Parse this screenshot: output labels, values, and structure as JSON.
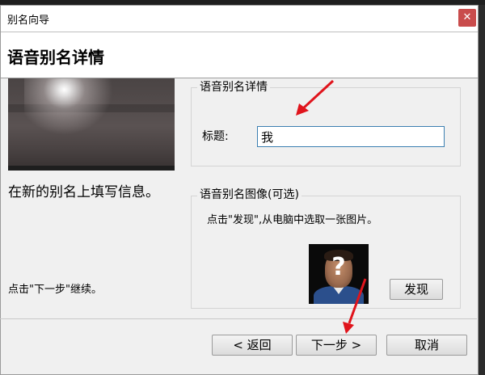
{
  "window": {
    "title": "别名向导",
    "close_glyph": "✕"
  },
  "header": {
    "title": "语音别名详情"
  },
  "sidebar": {
    "description": "在新的别名上填写信息。",
    "next_hint": "点击\"下一步\"继续。"
  },
  "details_group": {
    "title": "语音别名详情",
    "label": "标题:",
    "value": "我"
  },
  "image_group": {
    "title": "语音别名图像(可选)",
    "hint": "点击\"发现\",从电脑中选取一张图片。",
    "discover_label": "发现"
  },
  "footer": {
    "back_label": "< 返回",
    "next_label": "下一步 >",
    "cancel_label": "取消"
  },
  "colors": {
    "accent": "#3c7fb1",
    "annotation": "#e0141c",
    "close": "#c94c4c"
  },
  "icons": [
    "close-icon",
    "arrow-annotation-icon",
    "unknown-avatar-icon"
  ]
}
